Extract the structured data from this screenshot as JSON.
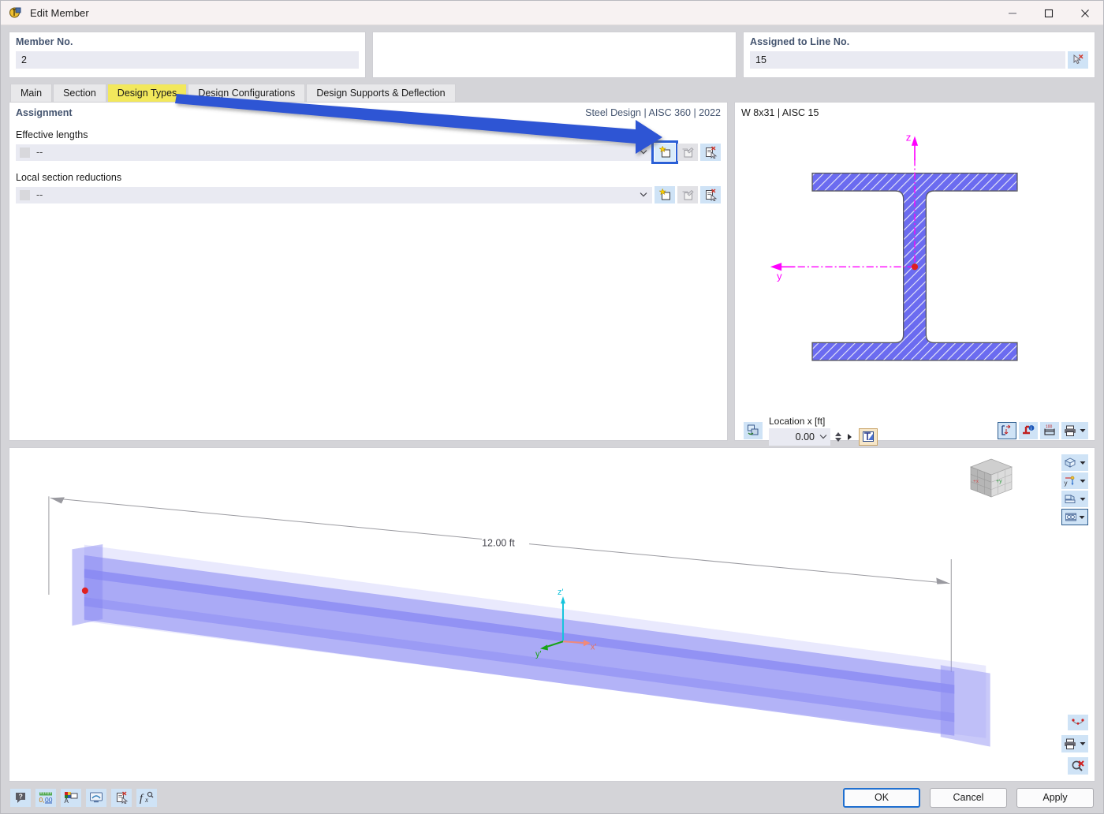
{
  "window": {
    "title": "Edit Member",
    "app_icon": "member-icon",
    "minimize": "—",
    "maximize": "☐",
    "close": "✕"
  },
  "header": {
    "member_no": {
      "label": "Member No.",
      "value": "2"
    },
    "blank_panel": {
      "label": "",
      "value": ""
    },
    "assigned_line": {
      "label": "Assigned to Line No.",
      "value": "15",
      "pick_icon": "select-line-icon"
    }
  },
  "tabs": [
    {
      "label": "Main",
      "active": false
    },
    {
      "label": "Section",
      "active": false
    },
    {
      "label": "Design Types",
      "active": true
    },
    {
      "label": "Design Configurations",
      "active": false
    },
    {
      "label": "Design Supports & Deflection",
      "active": false
    }
  ],
  "assignment": {
    "title": "Assignment",
    "standard": "Steel Design | AISC 360 | 2022",
    "rows": [
      {
        "label": "Effective lengths",
        "value": "--",
        "buttons": [
          {
            "name": "new-effective-length-button",
            "icon": "new-item-icon",
            "state": "highlighted"
          },
          {
            "name": "edit-effective-length-button",
            "icon": "edit-item-icon",
            "state": "disabled"
          },
          {
            "name": "delete-effective-length-button",
            "icon": "delete-item-icon",
            "state": "normal"
          }
        ]
      },
      {
        "label": "Local section reductions",
        "value": "--",
        "buttons": [
          {
            "name": "new-section-reduction-button",
            "icon": "new-item-icon",
            "state": "normal"
          },
          {
            "name": "edit-section-reduction-button",
            "icon": "edit-item-icon",
            "state": "disabled"
          },
          {
            "name": "delete-section-reduction-button",
            "icon": "delete-item-icon",
            "state": "normal"
          }
        ]
      }
    ]
  },
  "section_viewer": {
    "section_name": "W 8x31 | AISC 15",
    "axis_z_label": "z",
    "axis_y_label": "y",
    "location_label": "Location x [ft]",
    "location_value": "0.00",
    "left_tool": {
      "name": "rotate-section-icon"
    },
    "tools_right": [
      {
        "name": "section-dimensions-icon",
        "selected": true
      },
      {
        "name": "section-properties-icon",
        "selected": false
      },
      {
        "name": "section-measure-icon",
        "selected": false
      },
      {
        "name": "print-section-icon",
        "selected": false
      }
    ],
    "text_tool": {
      "name": "section-text-icon"
    }
  },
  "viewport_3d": {
    "dimension_label": "12.00 ft",
    "axis_labels": {
      "x": "x'",
      "y": "y'",
      "z": "z'"
    },
    "nav_cube": {
      "face_y": "+y",
      "face_x": "+x"
    },
    "tools": [
      {
        "name": "render-mode-button",
        "icon": "cube-icon",
        "selected": false
      },
      {
        "name": "view-direction-button",
        "icon": "axes-icon",
        "selected": false
      },
      {
        "name": "projection-button",
        "icon": "projection-icon",
        "selected": false
      },
      {
        "name": "display-style-button",
        "icon": "display-style-icon",
        "selected": true
      }
    ],
    "tools_bottom": [
      {
        "name": "view-reset-button",
        "icon": "smile-view-icon"
      },
      {
        "name": "print-view-button",
        "icon": "printer-icon"
      },
      {
        "name": "zoom-reset-button",
        "icon": "zoom-cancel-icon"
      }
    ]
  },
  "bottom_bar": {
    "tools": [
      {
        "name": "help-button",
        "icon": "help-bubble-icon"
      },
      {
        "name": "units-button",
        "icon": "decimal-places-icon"
      },
      {
        "name": "comment-button",
        "icon": "annotation-icon"
      },
      {
        "name": "display-settings-button",
        "icon": "monitor-icon"
      },
      {
        "name": "delete-button",
        "icon": "delete-doc-icon"
      },
      {
        "name": "formula-button",
        "icon": "function-icon"
      }
    ],
    "buttons": [
      {
        "label": "OK",
        "primary": true,
        "name": "ok-button"
      },
      {
        "label": "Cancel",
        "primary": false,
        "name": "cancel-button"
      },
      {
        "label": "Apply",
        "primary": false,
        "name": "apply-button"
      }
    ]
  },
  "annotation": {
    "arrow_color": "#2f55d4",
    "highlight_color": "#f2e85c"
  },
  "colors": {
    "accent_blue": "#2a5fd6",
    "section_fill": "#6b6bf0",
    "axis_magenta": "#ff00ff",
    "beam_fill": "#7a7af2"
  }
}
